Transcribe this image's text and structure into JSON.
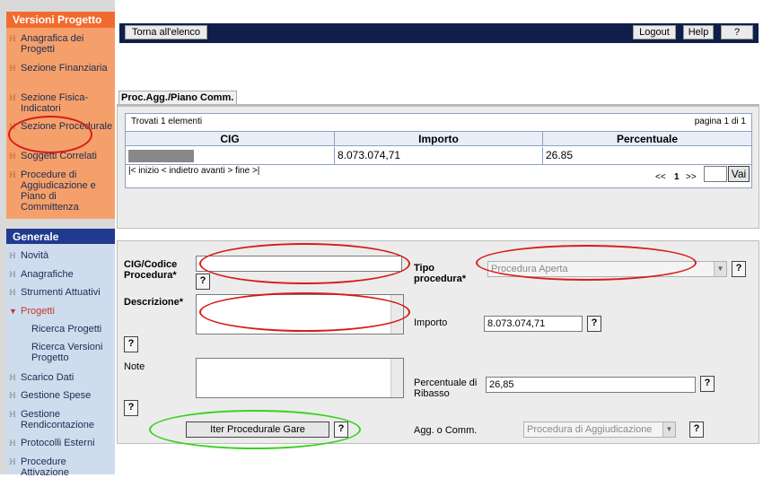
{
  "sidebar": {
    "versioni_title": "Versioni Progetto",
    "versioni_items": [
      "Anagrafica dei Progetti",
      "Sezione Finanziaria",
      "Sezione Fisica-Indicatori",
      "Sezione Procedurale",
      "Soggetti Correlati",
      "Procedure di Aggiudicazione e Piano di Committenza"
    ],
    "generale_title": "Generale",
    "generale_items": {
      "novita": "Novità",
      "anagrafiche": "Anagrafiche",
      "strumenti": "Strumenti Attuativi",
      "progetti": "Progetti",
      "ricerca_progetti": "Ricerca Progetti",
      "ricerca_versioni": "Ricerca Versioni Progetto",
      "scarico": "Scarico Dati",
      "gestione_spese": "Gestione Spese",
      "gestione_rend": "Gestione Rendicontazione",
      "protocolli": "Protocolli Esterni",
      "procedure_att": "Procedure Attivazione"
    }
  },
  "topbar": {
    "back_label": "Torna all'elenco",
    "logout_label": "Logout",
    "help_label": "Help",
    "q_label": "?"
  },
  "tab": {
    "label": "Proc.Agg./Piano Comm."
  },
  "grid": {
    "found_text": "Trovati 1 elementi",
    "page_text": "pagina 1 di 1",
    "headers": [
      "CIG",
      "Importo",
      "Percentuale"
    ],
    "rows": [
      {
        "cig": "",
        "importo": "8.073.074,71",
        "percentuale": "26.85"
      }
    ],
    "pager_text": "|< inizio < indietro avanti > fine >|",
    "nav_prev": "<<",
    "nav_page": "1",
    "nav_next": ">>",
    "go_label": "Vai"
  },
  "form": {
    "cig_label": "CIG/Codice Procedura*",
    "descrizione_label": "Descrizione*",
    "note_label": "Note",
    "tipo_label": "Tipo procedura*",
    "tipo_value": "Procedura Aperta",
    "importo_label": "Importo",
    "importo_value": "8.073.074,71",
    "ribasso_label": "Percentuale di Ribasso",
    "ribasso_value": "26,85",
    "agg_label": "Agg. o Comm.",
    "agg_value": "Procedura di Aggiudicazione",
    "iter_button": "Iter Procedurale Gare",
    "help": "?"
  },
  "colors": {
    "highlight_red": "#d81b1b",
    "highlight_green": "#38d21c",
    "topbar": "#0f1f4a",
    "orange_header": "#f26b2e"
  }
}
